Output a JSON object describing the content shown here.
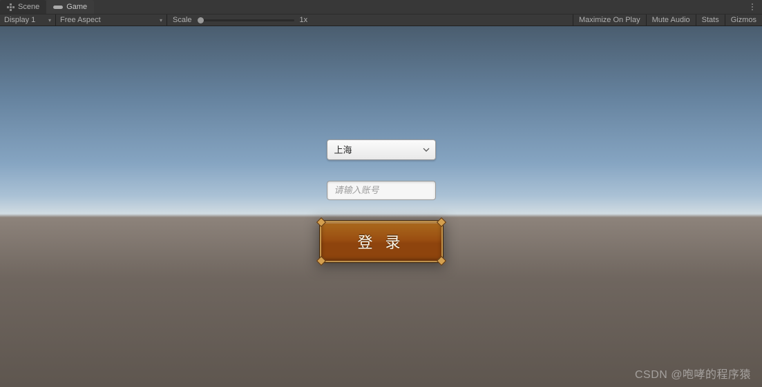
{
  "tabs": {
    "scene": "Scene",
    "game": "Game"
  },
  "toolbar": {
    "display": "Display 1",
    "aspect": "Free Aspect",
    "scale_label": "Scale",
    "scale_value": "1x",
    "maximize": "Maximize On Play",
    "mute": "Mute Audio",
    "stats": "Stats",
    "gizmos": "Gizmos"
  },
  "form": {
    "city_selected": "上海",
    "username_placeholder": "请输入账号",
    "login_label": "登 录"
  },
  "watermark": "CSDN @咆哮的程序猿"
}
